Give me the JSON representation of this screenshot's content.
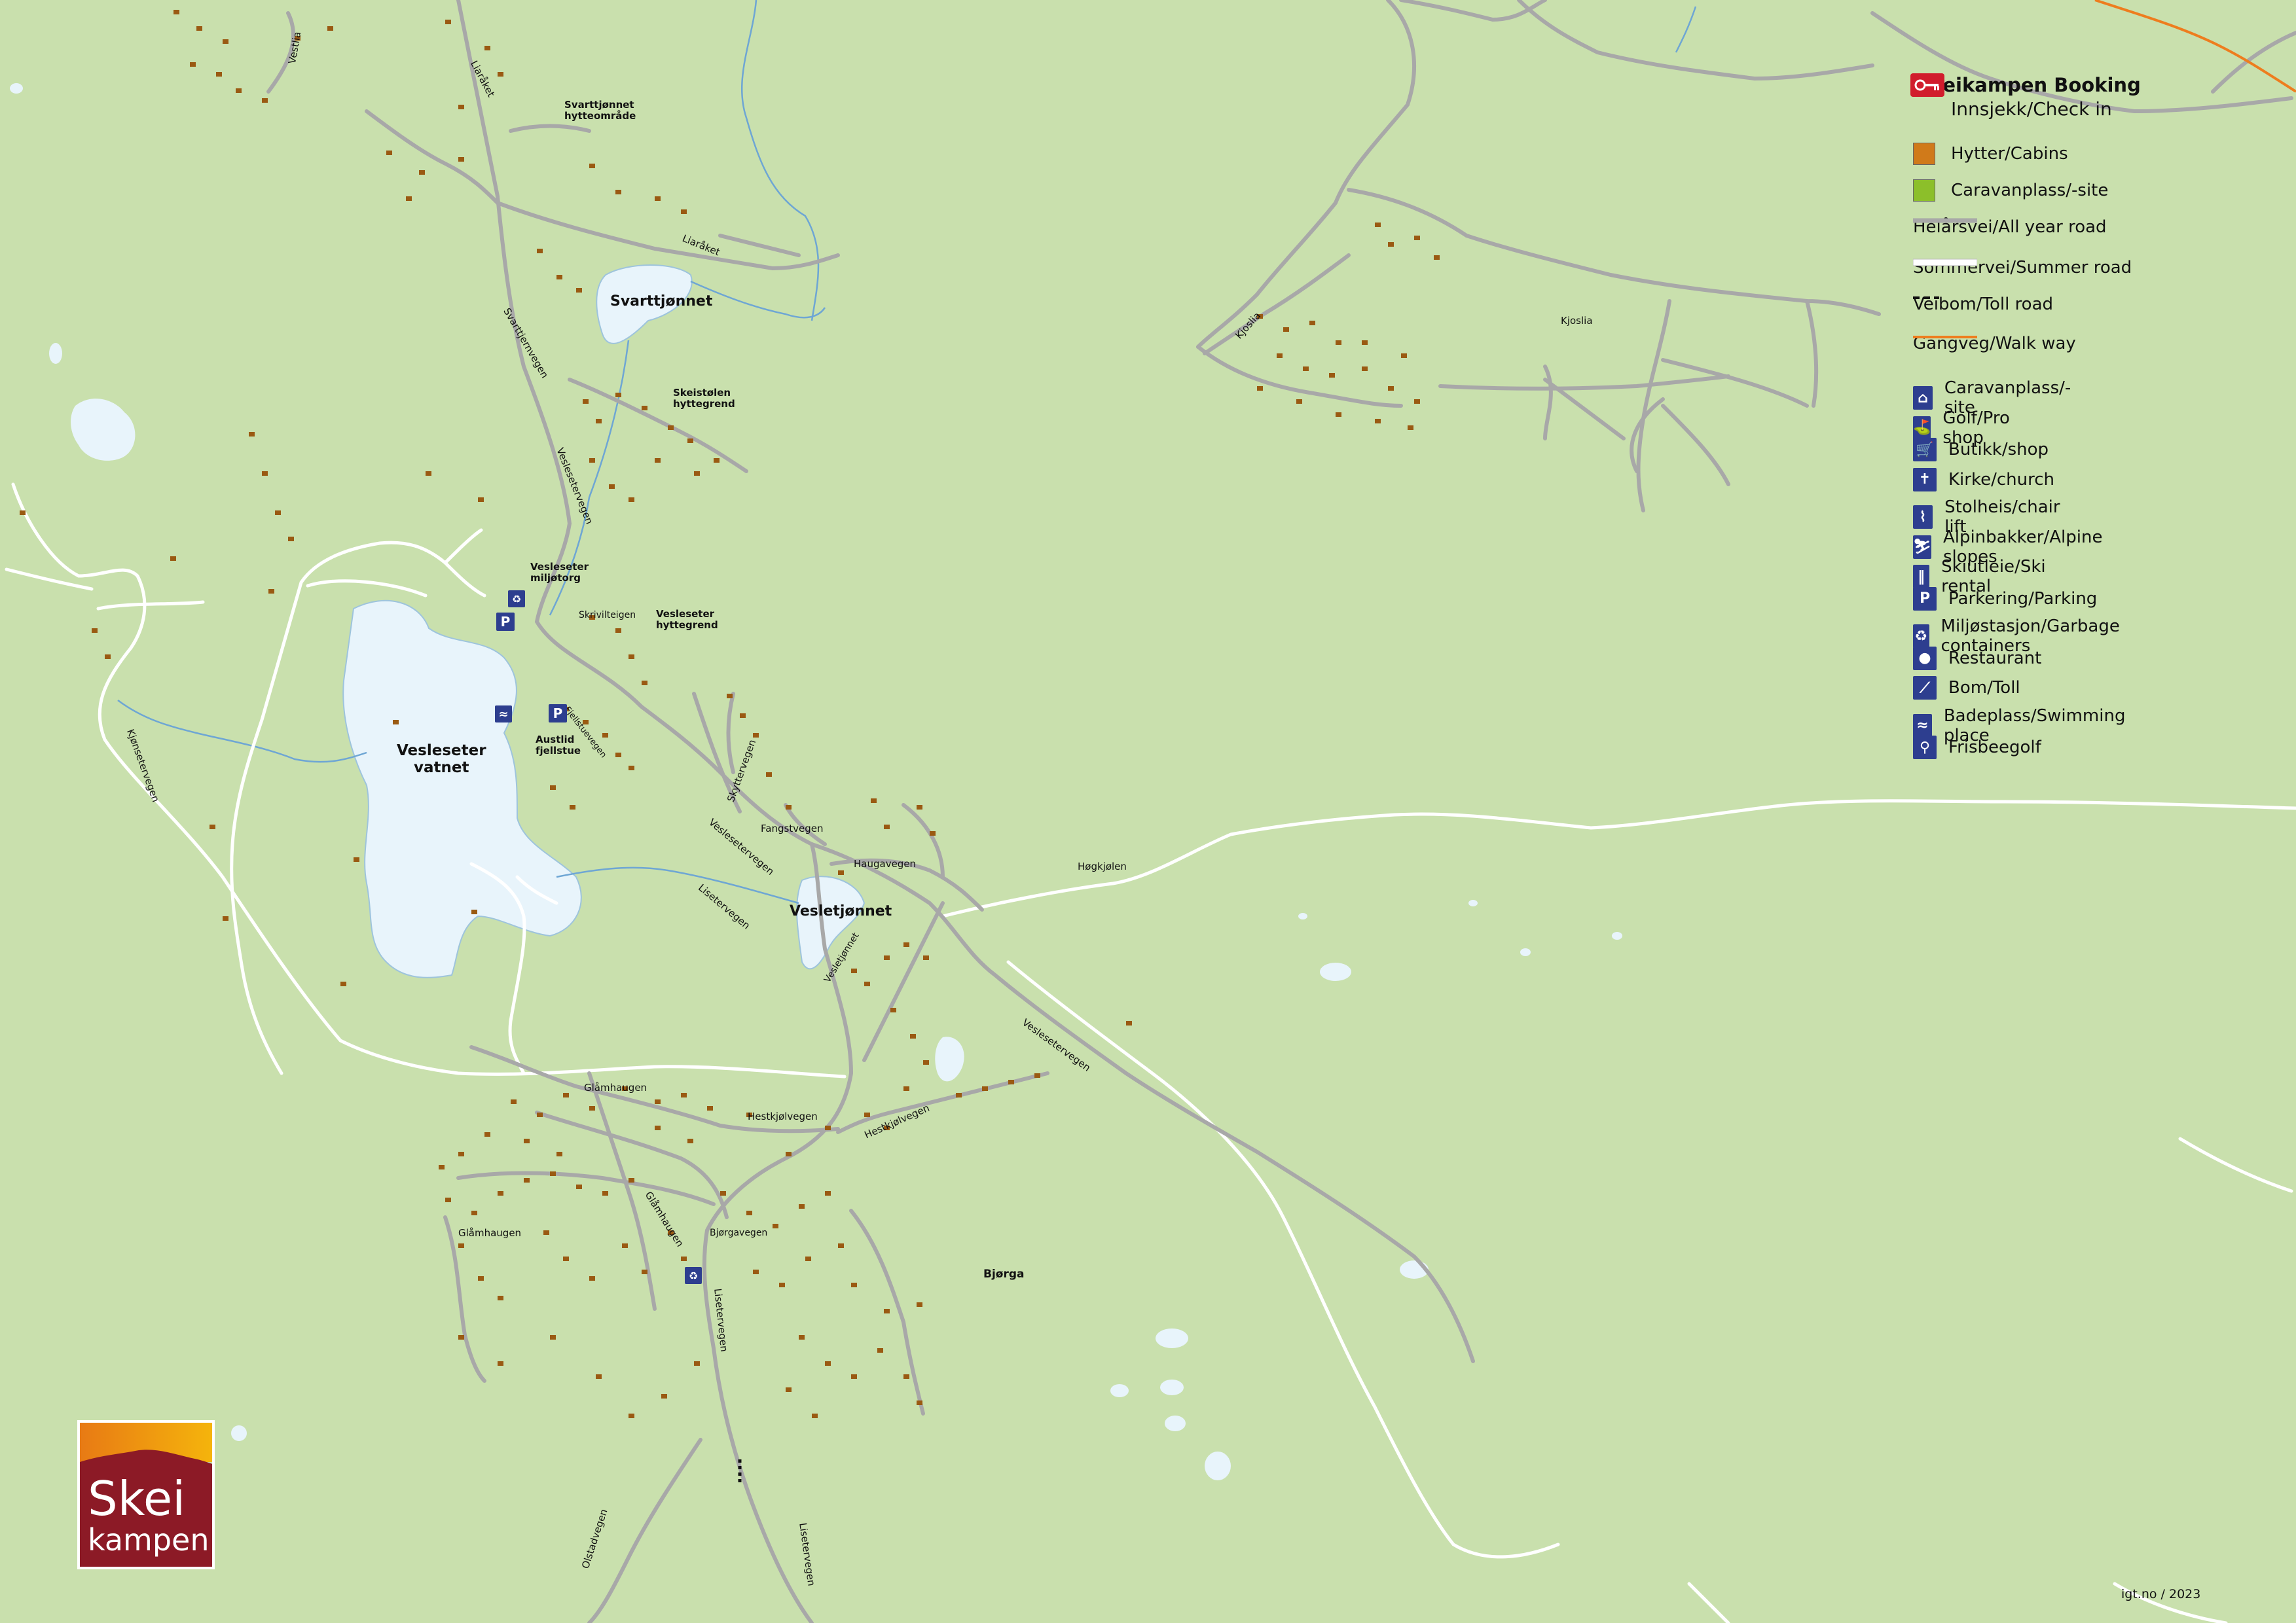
{
  "colors": {
    "background": "#c9e0ad",
    "water": "#e8f4fb",
    "stream": "#6ea6d4",
    "all_year_road": "#a8a8a8",
    "summer_road": "#ffffff",
    "toll_road": "#111111",
    "walk_way": "#ee7d1e",
    "cabins": "#d07a1a",
    "caravan": "#8cbf2a",
    "cabin_marks": "#9a5a12",
    "icon_blue": "#2d3e8f",
    "brand_red": "#8c1a26"
  },
  "legend": {
    "title": "Skeikampen Booking",
    "subtitle": "Innsjekk/Check in",
    "title_icon": "key-icon",
    "areas": [
      {
        "label": "Hytter/Cabins",
        "color": "#d07a1a"
      },
      {
        "label": "Caravanplass/-site",
        "color": "#8cbf2a"
      }
    ],
    "roads": [
      {
        "label": "Helårsvei/All year road",
        "style": "gray-thick"
      },
      {
        "label": "Sommervei/Summer road",
        "style": "white"
      },
      {
        "label": "Veibom/Toll road",
        "style": "black-dashed"
      },
      {
        "label": "Gangveg/Walk way",
        "style": "orange"
      }
    ],
    "icons": [
      {
        "label": "Caravanplass/-site",
        "icon": "caravan-icon",
        "glyph": "⌂"
      },
      {
        "label": "Golf/Pro shop",
        "icon": "golf-icon",
        "glyph": "⛳"
      },
      {
        "label": "Butikk/shop",
        "icon": "shop-cart-icon",
        "glyph": "🛒"
      },
      {
        "label": "Kirke/church",
        "icon": "church-icon",
        "glyph": "✝"
      },
      {
        "label": "Stolheis/chair lift",
        "icon": "chairlift-icon",
        "glyph": "⌇"
      },
      {
        "label": "Alpinbakker/Alpine slopes",
        "icon": "alpine-skier-icon",
        "glyph": "⛷"
      },
      {
        "label": "Skiutleie/Ski rental",
        "icon": "ski-rental-icon",
        "glyph": "‖"
      },
      {
        "label": "Parkering/Parking",
        "icon": "parking-icon",
        "glyph": "P"
      },
      {
        "label": "Miljøstasjon/Garbage containers",
        "icon": "recycling-icon",
        "glyph": "♻"
      },
      {
        "label": "Restaurant",
        "icon": "restaurant-icon",
        "glyph": "●"
      },
      {
        "label": "Bom/Toll",
        "icon": "toll-barrier-icon",
        "glyph": "⟋"
      },
      {
        "label": "Badeplass/Swimming place",
        "icon": "swimming-icon",
        "glyph": "≈"
      },
      {
        "label": "Frisbeegolf",
        "icon": "frisbee-golf-icon",
        "glyph": "⚲"
      }
    ]
  },
  "labels": {
    "vestlia": "Vestlia",
    "liaraket1": "Liaråket",
    "svarttjonnet_area": "Svarttjønnet\nhytteområde",
    "liaraket2": "Liaråket",
    "svarttjonnet": "Svarttjønnet",
    "svarttjernvegen": "Svarttjernvegen",
    "skeistolen": "Skeistølen\nhyttegrend",
    "veslesetervegen1": "Veslesetervegen",
    "miljotorg": "Vesleseter\nmiljøtorg",
    "skrivilteigen": "Skrivilteigen",
    "vesleseter_hyttegrend": "Vesleseter\nhyttegrend",
    "vesleseter_vatnet": "Vesleseter\nvatnet",
    "austlid": "Austlid\nfjellstue",
    "fjellstuevegen": "Fjellstuevegen",
    "kjonsetervegen": "Kjønsetervegen",
    "skyttervegen": "Skyttervegen",
    "fangstvegen": "Fangstvegen",
    "veslesetervegen2": "Veslesetervegen",
    "haugavegen": "Haugavegen",
    "lisetervegen1": "Lisetervegen",
    "vesletjonnet": "Vesletjønnet",
    "vesletjonnet_road": "Vesletjønnet",
    "hogkjolen": "Høgkjølen",
    "veslesetervegen3": "Veslesetervegen",
    "glamhaugen1": "Glåmhaugen",
    "hestkjolvegen1": "Hestkjølvegen",
    "hestkjolvegen2": "Hestkjølvegen",
    "glamhaugen2": "Glåmhaugen",
    "glamhaugen3": "Glåmhaugen",
    "bjorgavegen": "Bjørgavegen",
    "bjorga": "Bjørga",
    "lisetervegen2": "Lisetervegen",
    "olstadvegen": "Olstadvegen",
    "lisetervegen3": "Lisetervegen",
    "kjoslia_road": "Kjoslia",
    "kjoslia": "Kjoslia"
  },
  "logo": {
    "line1": "Skei",
    "line2": "kampen"
  },
  "credit": "igt.no  /  2023"
}
